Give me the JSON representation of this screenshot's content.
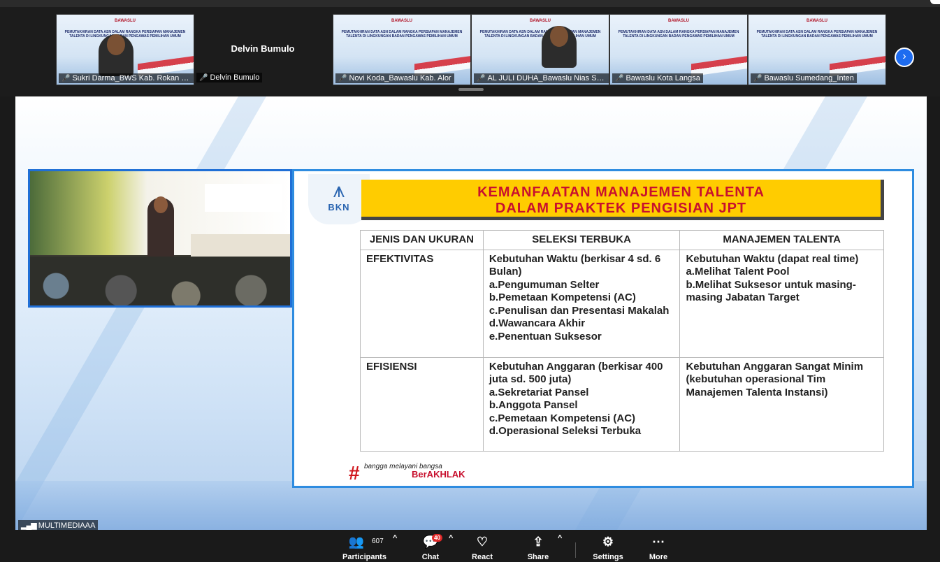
{
  "participants_strip": {
    "tiles": [
      {
        "name": "Sukri Darma_BWS Kab. Rokan H...",
        "kind": "video-person"
      },
      {
        "name": "Delvin Bumulo",
        "kind": "name-only",
        "display": "Delvin Bumulo"
      },
      {
        "name": "Novi Koda_Bawaslu Kab. Alor",
        "kind": "video"
      },
      {
        "name": "AL JULI DUHA_Bawaslu Nias Sela...",
        "kind": "video-person"
      },
      {
        "name": "Bawaslu Kota Langsa",
        "kind": "video"
      },
      {
        "name": "Bawaslu Sumedang_Inten",
        "kind": "video"
      }
    ],
    "tile_header": "BAWASLU",
    "tile_caption": "PEMUTAKHIRAN DATA ASN DALAM RANGKA PERSIAPAN MANAJEMEN TALENTA DI LINGKUNGAN BADAN PENGAWAS PEMILIHAN UMUM",
    "next_icon": "chevron-right-icon"
  },
  "slide": {
    "logo_text": "BKN",
    "title_line1": "KEMANFAATAN MANAJEMEN TALENTA",
    "title_line2": "DALAM PRAKTEK PENGISIAN JPT",
    "headers": [
      "JENIS DAN UKURAN",
      "SELEKSI TERBUKA",
      "MANAJEMEN TALENTA"
    ],
    "rows": [
      {
        "label": "EFEKTIVITAS",
        "seleksi_intro": "Kebutuhan Waktu (berkisar 4 sd. 6 Bulan)",
        "seleksi_items": [
          "a.Pengumuman Selter",
          "b.Pemetaan Kompetensi (AC)",
          "c.Penulisan dan Presentasi Makalah",
          "d.Wawancara Akhir",
          "e.Penentuan Suksesor"
        ],
        "mt_intro": "Kebutuhan Waktu (dapat real time)",
        "mt_items": [
          "a.Melihat Talent Pool",
          "b.Melihat Suksesor untuk masing-masing Jabatan Target"
        ]
      },
      {
        "label": "EFISIENSI",
        "seleksi_intro": "Kebutuhan Anggaran (berkisar 400 juta sd. 500 juta)",
        "seleksi_items": [
          "a.Sekretariat Pansel",
          "b.Anggota Pansel",
          "c.Pemetaan Kompetensi (AC)",
          "d.Operasional Seleksi Terbuka"
        ],
        "mt_intro": "Kebutuhan Anggaran Sangat Minim (kebutuhan operasional Tim Manajemen Talenta Instansi)",
        "mt_items": []
      }
    ],
    "footer_tag": "bangga melayani bangsa",
    "footer_brand": "BerAKHLAK"
  },
  "stage_name": "MULTIMEDIAAA",
  "toolbar": {
    "participants_label": "Participants",
    "participants_count": "607",
    "chat_label": "Chat",
    "chat_badge": "40",
    "react_label": "React",
    "share_label": "Share",
    "settings_label": "Settings",
    "more_label": "More"
  }
}
